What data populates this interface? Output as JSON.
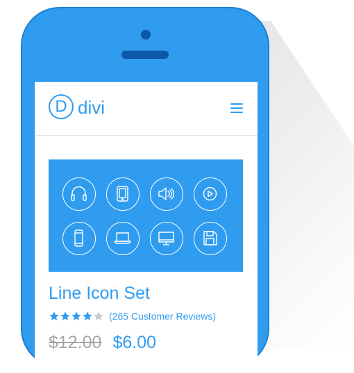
{
  "brand": {
    "logo_letter": "D",
    "name": "divi",
    "accent_color": "#2f9cf0"
  },
  "header": {
    "menu_icon": "hamburger-menu-icon"
  },
  "banner": {
    "icons": [
      "headphones-icon",
      "tablet-icon",
      "speaker-icon",
      "play-icon",
      "smartphone-icon",
      "laptop-icon",
      "monitor-icon",
      "floppy-disk-icon"
    ]
  },
  "product": {
    "title": "Line Icon Set",
    "rating": 4,
    "rating_max": 5,
    "reviews": "(265 Customer Reviews)",
    "old_price": "$12.00",
    "new_price": "$6.00"
  }
}
